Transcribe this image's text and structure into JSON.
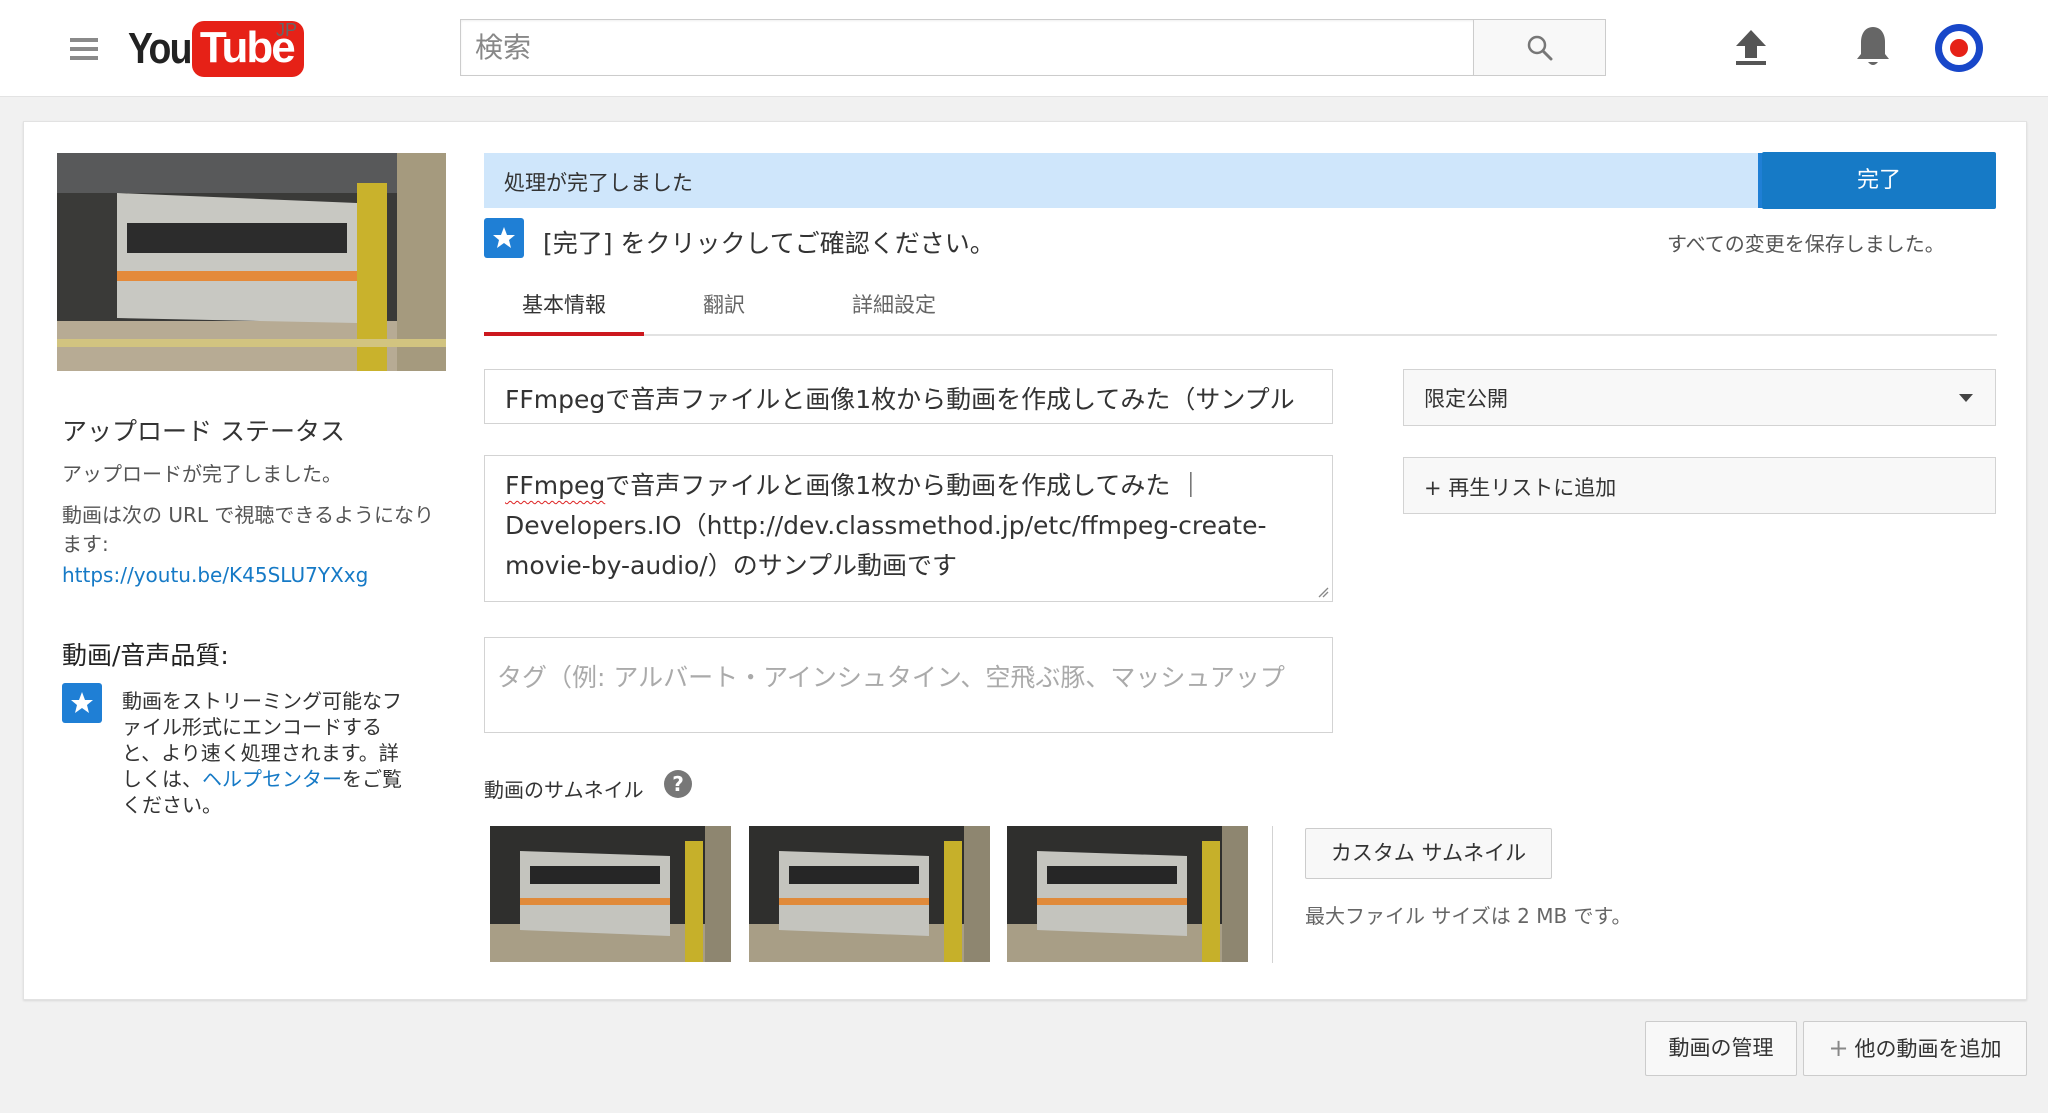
{
  "header": {
    "logo_you": "You",
    "logo_tube": "Tube",
    "logo_region": "JP",
    "search_placeholder": "検索"
  },
  "sidebar": {
    "upload_status_title": "アップロード ステータス",
    "upload_complete": "アップロードが完了しました。",
    "url_intro": "動画は次の URL で視聴できるようになります:",
    "video_url": "https://youtu.be/K45SLU7YXxg",
    "quality_title": "動画/音声品質:",
    "quality_text": "動画をストリーミング可能なファイル形式にエンコードすると、より速く処理されます。詳しくは、",
    "help_center_link": "ヘルプセンター",
    "quality_suffix": "をご覧ください。"
  },
  "status": {
    "processing_done": "処理が完了しました",
    "done_button": "完了",
    "hint": "[完了] をクリックしてご確認ください。",
    "saved": "すべての変更を保存しました。"
  },
  "tabs": [
    {
      "label": "基本情報",
      "active": true
    },
    {
      "label": "翻訳",
      "active": false
    },
    {
      "label": "詳細設定",
      "active": false
    }
  ],
  "form": {
    "title_value": "FFmpegで音声ファイルと画像1枚から動画を作成してみた（サンプル",
    "desc_first_word": "FFmpeg",
    "desc_rest": "で音声ファイルと画像1枚から動画を作成してみた ｜ Developers.IO（http://dev.classmethod.jp/etc/ffmpeg-create-movie-by-audio/）のサンプル動画です",
    "tags_placeholder": "タグ（例: アルバート・アインシュタイン、空飛ぶ豚、マッシュアップ",
    "privacy_value": "限定公開",
    "playlist_button": "+ 再生リストに追加",
    "thumbnail_title": "動画のサムネイル",
    "help_icon": "?",
    "custom_thumbnail_button": "カスタム サムネイル",
    "max_file_size": "最大ファイル サイズは 2 MB です。"
  },
  "footer": {
    "manage_videos": "動画の管理",
    "add_more_videos": "他の動画を追加"
  },
  "colors": {
    "brand_red": "#e62117",
    "accent_blue": "#167ac6",
    "status_bg": "#cfe6fb"
  }
}
